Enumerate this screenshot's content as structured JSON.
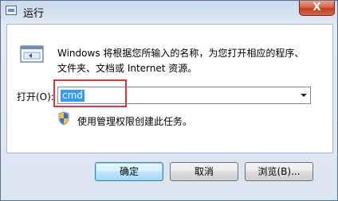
{
  "window": {
    "title": "运行",
    "close_glyph": "X"
  },
  "description": {
    "line1": "Windows 将根据您所输入的名称，为您打开相应的程序、",
    "line2": "文件夹、文档或 Internet 资源。"
  },
  "open_field": {
    "label": "打开(O):",
    "value": "cmd"
  },
  "admin_note": "使用管理权限创建此任务。",
  "buttons": {
    "ok": "确定",
    "cancel": "取消",
    "browse": "浏览(B)..."
  },
  "icons": {
    "title_icon": "run-icon",
    "app_icon": "run-program-icon",
    "shield_icon": "uac-shield-icon",
    "dropdown_icon": "chevron-down-icon"
  },
  "colors": {
    "selection": "#3399ff",
    "annotation": "#e8313a",
    "close_button": "#c23d1f"
  }
}
